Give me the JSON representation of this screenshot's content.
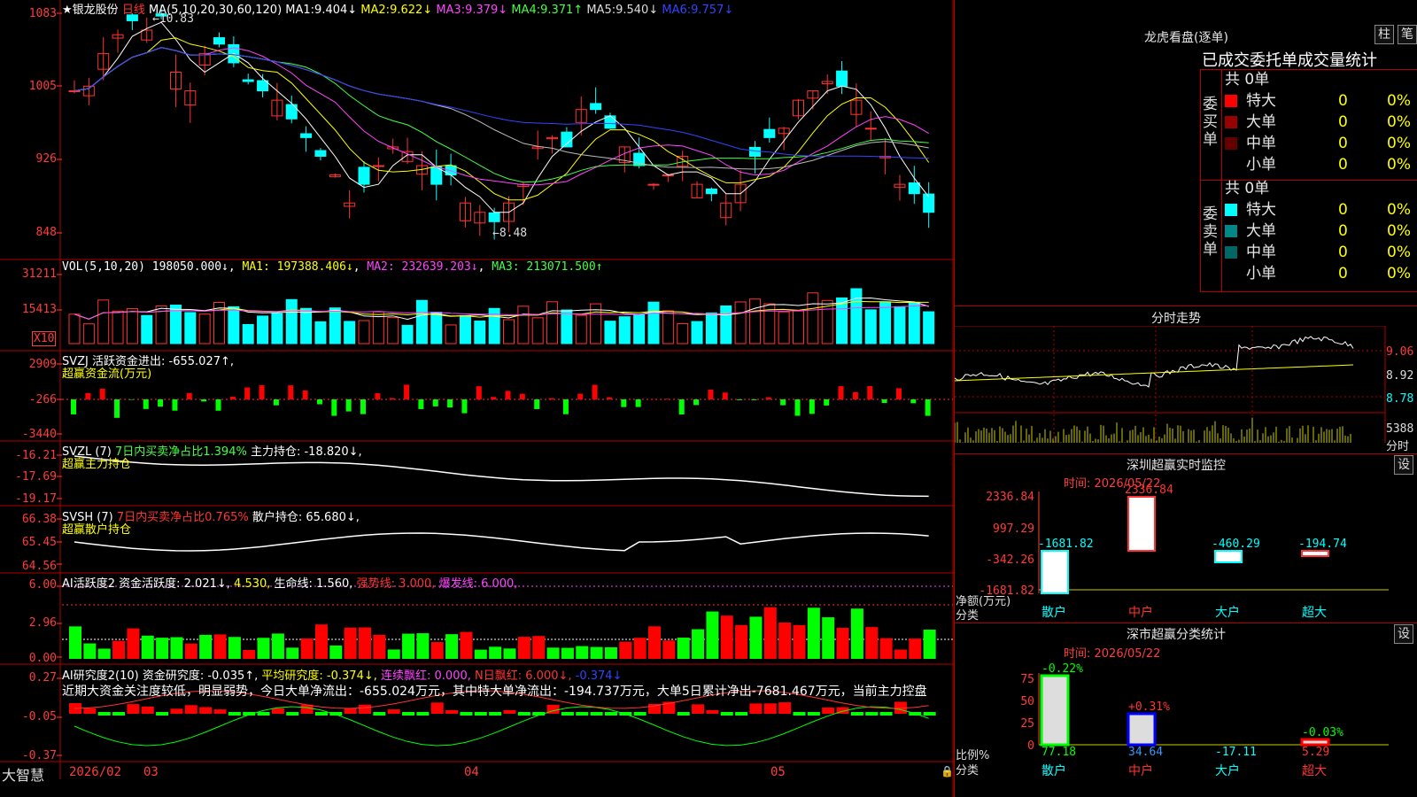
{
  "stock": {
    "star": "★",
    "name": "银龙股份",
    "period": "日线",
    "ma_label": "MA(5,10,20,30,60,120)",
    "high_mark": "10.83",
    "low_mark": "8.48"
  },
  "ma_values": [
    {
      "label": "MA1:",
      "value": "9.404↓",
      "color": "#ffffff"
    },
    {
      "label": "MA2:",
      "value": "9.622↓",
      "color": "#ffff00"
    },
    {
      "label": "MA3:",
      "value": "9.379↓",
      "color": "#ff44ff"
    },
    {
      "label": "MA4:",
      "value": "9.371↑",
      "color": "#44ff44"
    },
    {
      "label": "MA5:",
      "value": "9.540↓",
      "color": "#dddddd"
    },
    {
      "label": "MA6:",
      "value": "9.757↓",
      "color": "#3344ff"
    }
  ],
  "price_axis": [
    "1083",
    "1005",
    "926",
    "848"
  ],
  "vol": {
    "label": "VOL(5,10,20)",
    "value": "198050.000↓",
    "ma1": "MA1: 197388.406↓",
    "ma2": "MA2: 232639.203↓",
    "ma3": "MA3: 213071.500↑",
    "axis": [
      "31211",
      "15413"
    ],
    "unit": "X10"
  },
  "svzj": {
    "label": "SVZJ",
    "desc": "活跃资金进出: -655.027↑,",
    "sub": "超赢资金流(万元)",
    "axis": [
      "2909",
      "-266",
      "-3440"
    ]
  },
  "svzl": {
    "label": "SVZL (7)",
    "desc": "7日内买卖净占比1.394%",
    "hold": "主力持仓: -18.820↓,",
    "sub": "超赢主力持仓",
    "axis": [
      "-16.21",
      "-17.69",
      "-19.17"
    ]
  },
  "svsh": {
    "label": "SVSH (7)",
    "desc": "7日内买卖净占比0.765%",
    "hold": "散户持仓: 65.680↓,",
    "sub": "超赢散户持仓",
    "axis": [
      "66.38",
      "65.45",
      "64.56"
    ]
  },
  "ai_active": {
    "label": "AI活跃度2",
    "desc": "资金活跃度: 2.021↓,",
    "v2": "4.530,",
    "life": "生命线: 1.560,",
    "strong": "强势线: 3.000,",
    "burst": "爆发线: 6.000,",
    "axis": [
      "6.00",
      "2.96",
      "0.00"
    ]
  },
  "ai_research": {
    "label": "AI研究度2(10)",
    "desc": "资金研究度: -0.035↑,",
    "avg": "平均研究度: -0.374↓,",
    "red": "连续飘红: 0.000,",
    "nred": "N日飘红: 6.000↓,",
    "last": "-0.374↓",
    "text": "近期大资金关注度较低，明显弱势，今日大单净流出：-655.024万元，其中特大单净流出：-194.737万元，大单5日累计净出-7681.467万元，当前主力控盘",
    "axis": [
      "0.27",
      "-0.05",
      "-0.37"
    ]
  },
  "bottom": {
    "brand": "大智慧",
    "date": "2026/02",
    "months": [
      "03",
      "04",
      "05"
    ]
  },
  "dragon": {
    "title": "龙虎看盘(逐单)",
    "btn1": "柱",
    "btn2": "笔",
    "subtitle": "已成交委托单成交量统计",
    "buy": {
      "side": "委买单",
      "total": "共 0单",
      "rows": [
        {
          "name": "特大",
          "v": "0",
          "p": "0%",
          "c": "#ff0000"
        },
        {
          "name": "大单",
          "v": "0",
          "p": "0%",
          "c": "#990000"
        },
        {
          "name": "中单",
          "v": "0",
          "p": "0%",
          "c": "#660000"
        },
        {
          "name": "小单",
          "v": "0",
          "p": "0%",
          "c": "#000000"
        }
      ]
    },
    "sell": {
      "side": "委卖单",
      "total": "共 0单",
      "rows": [
        {
          "name": "特大",
          "v": "0",
          "p": "0%",
          "c": "#00ffff"
        },
        {
          "name": "大单",
          "v": "0",
          "p": "0%",
          "c": "#008888"
        },
        {
          "name": "中单",
          "v": "0",
          "p": "0%",
          "c": "#006666"
        },
        {
          "name": "小单",
          "v": "0",
          "p": "0%",
          "c": "#000000"
        }
      ]
    }
  },
  "intraday": {
    "title": "分时走势",
    "axis": [
      "9.06",
      "8.92",
      "8.78"
    ],
    "vol": "5388",
    "unit": "分时"
  },
  "monitor": {
    "title": "深圳超赢实时监控",
    "btn": "设",
    "time": "时间: 2026/05/22",
    "axis": [
      "2336.84",
      "997.29",
      "-342.26",
      "-1681.82"
    ],
    "ylabel": "净额(万元)",
    "xlabel": "分类",
    "cats": [
      "散户",
      "中户",
      "大户",
      "超大"
    ],
    "values": [
      "-1681.82",
      "2336.84",
      "-460.29",
      "-194.74"
    ]
  },
  "classify": {
    "title": "深市超赢分类统计",
    "btn": "设",
    "time": "时间: 2026/05/22",
    "axis": [
      "75",
      "50",
      "25",
      "0"
    ],
    "ylabel": "比例%",
    "xlabel": "分类",
    "cats": [
      "散户",
      "中户",
      "大户",
      "超大"
    ],
    "changes": [
      "-0.22%",
      "+0.31%",
      "",
      "-0.03%"
    ],
    "values": [
      "77.18",
      "34.64",
      "-17.11",
      "5.29"
    ]
  }
}
